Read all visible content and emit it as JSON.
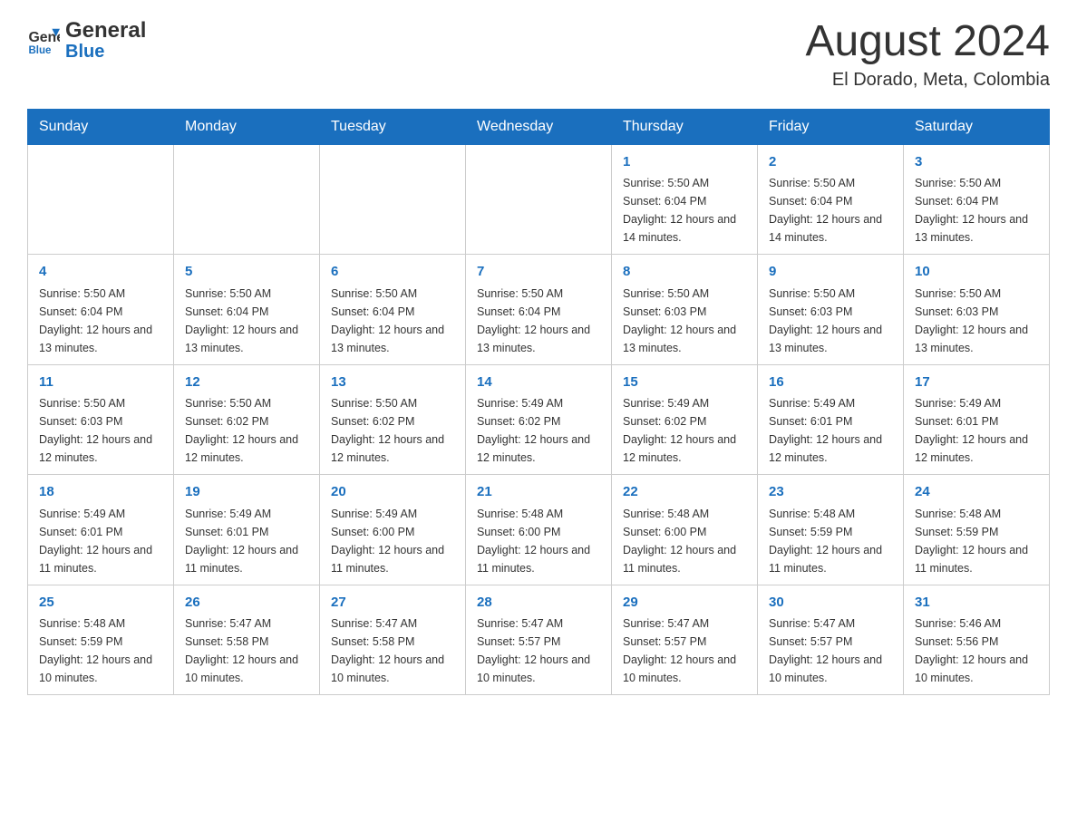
{
  "header": {
    "logo_general": "General",
    "logo_blue": "Blue",
    "title": "August 2024",
    "subtitle": "El Dorado, Meta, Colombia"
  },
  "days_of_week": [
    "Sunday",
    "Monday",
    "Tuesday",
    "Wednesday",
    "Thursday",
    "Friday",
    "Saturday"
  ],
  "weeks": [
    {
      "days": [
        {
          "number": "",
          "info": ""
        },
        {
          "number": "",
          "info": ""
        },
        {
          "number": "",
          "info": ""
        },
        {
          "number": "",
          "info": ""
        },
        {
          "number": "1",
          "info": "Sunrise: 5:50 AM\nSunset: 6:04 PM\nDaylight: 12 hours and 14 minutes."
        },
        {
          "number": "2",
          "info": "Sunrise: 5:50 AM\nSunset: 6:04 PM\nDaylight: 12 hours and 14 minutes."
        },
        {
          "number": "3",
          "info": "Sunrise: 5:50 AM\nSunset: 6:04 PM\nDaylight: 12 hours and 13 minutes."
        }
      ]
    },
    {
      "days": [
        {
          "number": "4",
          "info": "Sunrise: 5:50 AM\nSunset: 6:04 PM\nDaylight: 12 hours and 13 minutes."
        },
        {
          "number": "5",
          "info": "Sunrise: 5:50 AM\nSunset: 6:04 PM\nDaylight: 12 hours and 13 minutes."
        },
        {
          "number": "6",
          "info": "Sunrise: 5:50 AM\nSunset: 6:04 PM\nDaylight: 12 hours and 13 minutes."
        },
        {
          "number": "7",
          "info": "Sunrise: 5:50 AM\nSunset: 6:04 PM\nDaylight: 12 hours and 13 minutes."
        },
        {
          "number": "8",
          "info": "Sunrise: 5:50 AM\nSunset: 6:03 PM\nDaylight: 12 hours and 13 minutes."
        },
        {
          "number": "9",
          "info": "Sunrise: 5:50 AM\nSunset: 6:03 PM\nDaylight: 12 hours and 13 minutes."
        },
        {
          "number": "10",
          "info": "Sunrise: 5:50 AM\nSunset: 6:03 PM\nDaylight: 12 hours and 13 minutes."
        }
      ]
    },
    {
      "days": [
        {
          "number": "11",
          "info": "Sunrise: 5:50 AM\nSunset: 6:03 PM\nDaylight: 12 hours and 12 minutes."
        },
        {
          "number": "12",
          "info": "Sunrise: 5:50 AM\nSunset: 6:02 PM\nDaylight: 12 hours and 12 minutes."
        },
        {
          "number": "13",
          "info": "Sunrise: 5:50 AM\nSunset: 6:02 PM\nDaylight: 12 hours and 12 minutes."
        },
        {
          "number": "14",
          "info": "Sunrise: 5:49 AM\nSunset: 6:02 PM\nDaylight: 12 hours and 12 minutes."
        },
        {
          "number": "15",
          "info": "Sunrise: 5:49 AM\nSunset: 6:02 PM\nDaylight: 12 hours and 12 minutes."
        },
        {
          "number": "16",
          "info": "Sunrise: 5:49 AM\nSunset: 6:01 PM\nDaylight: 12 hours and 12 minutes."
        },
        {
          "number": "17",
          "info": "Sunrise: 5:49 AM\nSunset: 6:01 PM\nDaylight: 12 hours and 12 minutes."
        }
      ]
    },
    {
      "days": [
        {
          "number": "18",
          "info": "Sunrise: 5:49 AM\nSunset: 6:01 PM\nDaylight: 12 hours and 11 minutes."
        },
        {
          "number": "19",
          "info": "Sunrise: 5:49 AM\nSunset: 6:01 PM\nDaylight: 12 hours and 11 minutes."
        },
        {
          "number": "20",
          "info": "Sunrise: 5:49 AM\nSunset: 6:00 PM\nDaylight: 12 hours and 11 minutes."
        },
        {
          "number": "21",
          "info": "Sunrise: 5:48 AM\nSunset: 6:00 PM\nDaylight: 12 hours and 11 minutes."
        },
        {
          "number": "22",
          "info": "Sunrise: 5:48 AM\nSunset: 6:00 PM\nDaylight: 12 hours and 11 minutes."
        },
        {
          "number": "23",
          "info": "Sunrise: 5:48 AM\nSunset: 5:59 PM\nDaylight: 12 hours and 11 minutes."
        },
        {
          "number": "24",
          "info": "Sunrise: 5:48 AM\nSunset: 5:59 PM\nDaylight: 12 hours and 11 minutes."
        }
      ]
    },
    {
      "days": [
        {
          "number": "25",
          "info": "Sunrise: 5:48 AM\nSunset: 5:59 PM\nDaylight: 12 hours and 10 minutes."
        },
        {
          "number": "26",
          "info": "Sunrise: 5:47 AM\nSunset: 5:58 PM\nDaylight: 12 hours and 10 minutes."
        },
        {
          "number": "27",
          "info": "Sunrise: 5:47 AM\nSunset: 5:58 PM\nDaylight: 12 hours and 10 minutes."
        },
        {
          "number": "28",
          "info": "Sunrise: 5:47 AM\nSunset: 5:57 PM\nDaylight: 12 hours and 10 minutes."
        },
        {
          "number": "29",
          "info": "Sunrise: 5:47 AM\nSunset: 5:57 PM\nDaylight: 12 hours and 10 minutes."
        },
        {
          "number": "30",
          "info": "Sunrise: 5:47 AM\nSunset: 5:57 PM\nDaylight: 12 hours and 10 minutes."
        },
        {
          "number": "31",
          "info": "Sunrise: 5:46 AM\nSunset: 5:56 PM\nDaylight: 12 hours and 10 minutes."
        }
      ]
    }
  ]
}
